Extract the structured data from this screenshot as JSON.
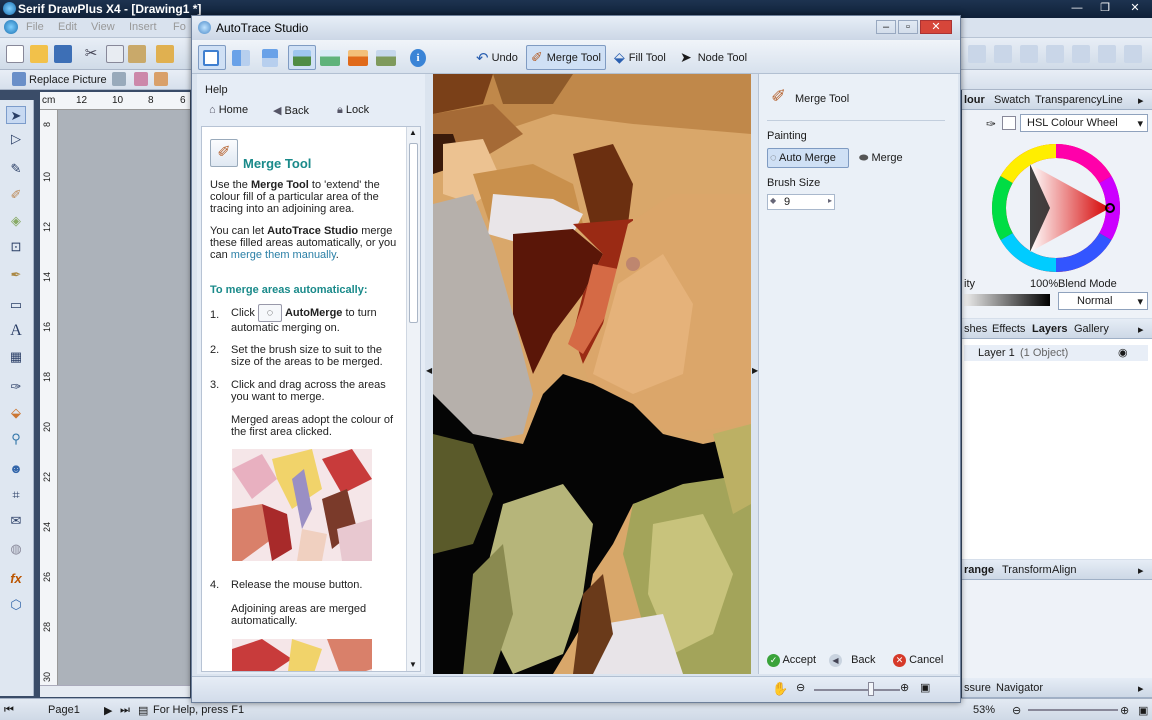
{
  "app": {
    "title": "Serif DrawPlus X4 - [Drawing1 *]",
    "menu": [
      "File",
      "Edit",
      "View",
      "Insert",
      "Fo"
    ],
    "replace_picture": "Replace Picture"
  },
  "ruler": {
    "top_ticks": [
      "cm",
      "12",
      "10",
      "8",
      "6"
    ],
    "left_ticks": [
      "8",
      "10",
      "12",
      "14",
      "16",
      "18",
      "20",
      "22",
      "24",
      "26",
      "28",
      "30"
    ]
  },
  "status": {
    "page": "Page1",
    "help": "For Help, press F1",
    "zoom": "53%"
  },
  "right_panels": {
    "color_tabs": [
      "lour",
      "Swatch",
      "Transparency",
      "Line"
    ],
    "color_model": "HSL Colour Wheel",
    "opacity_label": "ity",
    "opacity_value": "100%",
    "blend_label": "Blend Mode",
    "blend_value": "Normal",
    "layer_tabs": [
      "shes",
      "Effects",
      "Layers",
      "Gallery"
    ],
    "layer_name": "Layer 1",
    "layer_count": "(1 Object)",
    "arrange_tabs": [
      "range",
      "Transform",
      "Align"
    ],
    "nav_tabs": [
      "ssure",
      "Navigator"
    ]
  },
  "dialog": {
    "title": "AutoTrace Studio",
    "toolbar": {
      "undo": "Undo",
      "merge_tool": "Merge Tool",
      "fill_tool": "Fill Tool",
      "node_tool": "Node Tool"
    },
    "help": {
      "label": "Help",
      "home": "Home",
      "back": "Back",
      "lock": "Lock",
      "title": "Merge Tool",
      "p1_a": "Use the ",
      "p1_b": "Merge Tool",
      "p1_c": " to 'extend' the colour fill of a particular area of the tracing into an adjoining area.",
      "p2_a": "You can let ",
      "p2_b": "AutoTrace Studio",
      "p2_c": " merge these filled areas automatically, or you can ",
      "p2_link": "merge them manually",
      "p2_d": ".",
      "heading": "To merge areas automatically:",
      "step1_num": "1.",
      "step1_a": "Click",
      "step1_b": "AutoMerge",
      "step1_c": " to turn automatic merging on.",
      "step2_num": "2.",
      "step2": "Set the brush size to suit to the size of the areas to be merged.",
      "step3_num": "3.",
      "step3": "Click and drag across the areas you want to merge.",
      "step3_note": "Merged areas adopt the colour of the first area clicked.",
      "step4_num": "4.",
      "step4": "Release the mouse button.",
      "step4_note": "Adjoining areas are merged automatically."
    },
    "props": {
      "tool_name": "Merge Tool",
      "painting_label": "Painting",
      "auto_merge": "Auto Merge",
      "merge": "Merge",
      "brush_size_label": "Brush Size",
      "brush_size_value": "9"
    },
    "footer": {
      "accept": "Accept",
      "back": "Back",
      "cancel": "Cancel"
    }
  },
  "colors": {
    "titlebar": "#1d3350",
    "accent": "#1a8a8a",
    "link": "#2a7fa6",
    "active_button": "#cfe0f5"
  }
}
